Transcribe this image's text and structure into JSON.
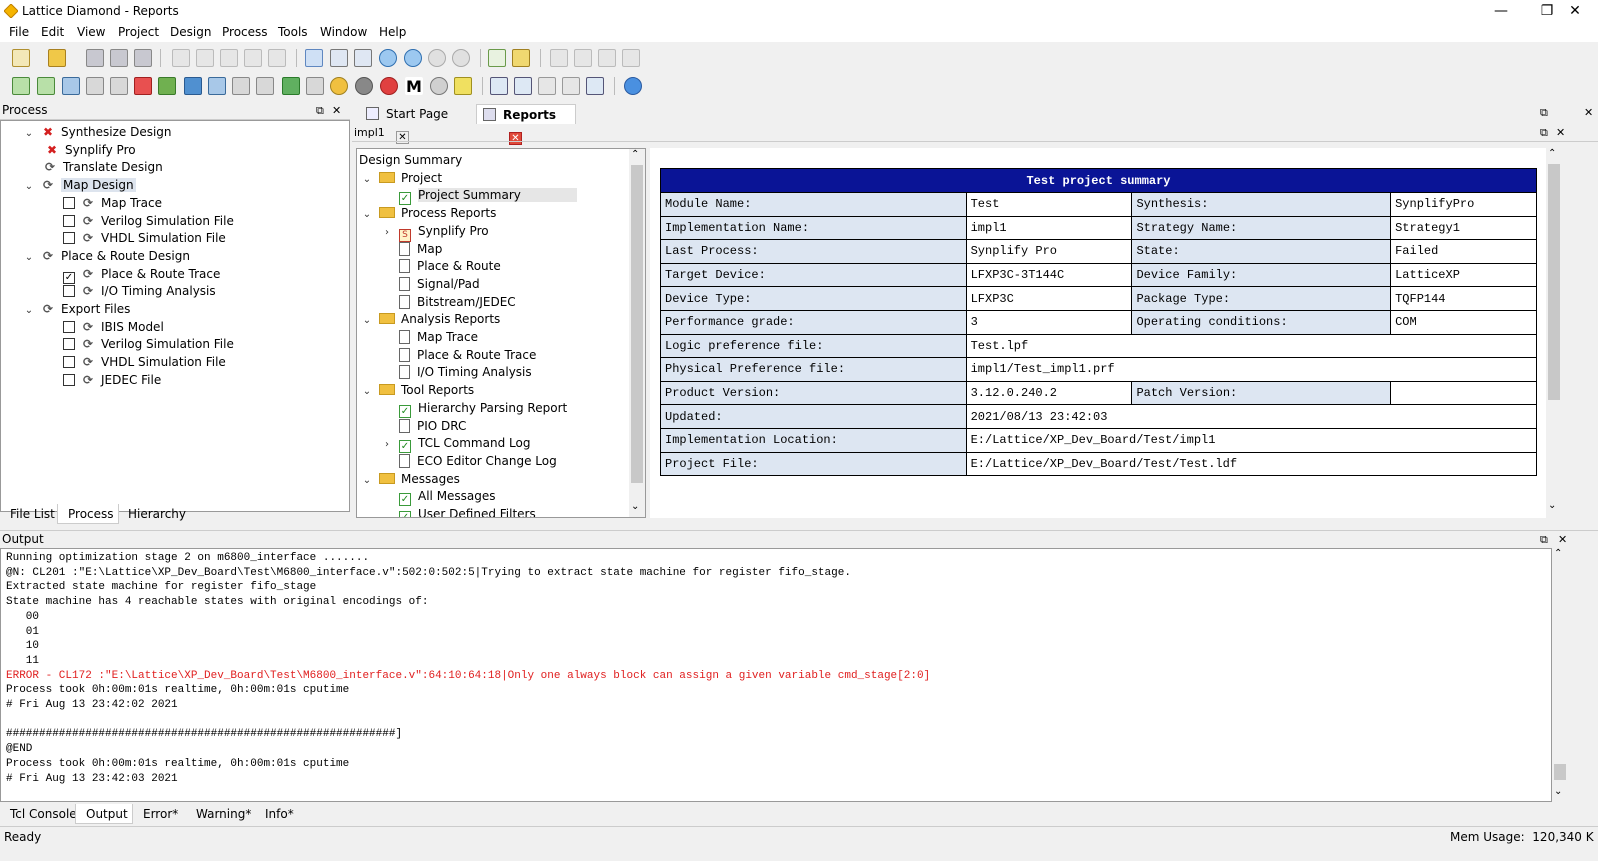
{
  "window": {
    "title": "Lattice Diamond - Reports",
    "min": "—",
    "max": "❐",
    "close": "✕"
  },
  "menu": [
    "File",
    "Edit",
    "View",
    "Project",
    "Design",
    "Process",
    "Tools",
    "Window",
    "Help"
  ],
  "process_pane": {
    "title": "Process",
    "items": [
      {
        "label": "Synthesize Design",
        "indent": 0,
        "caret": "v",
        "icon": "x"
      },
      {
        "label": "Synplify Pro",
        "indent": 1,
        "icon": "x"
      },
      {
        "label": "Translate Design",
        "indent": 0,
        "icon": "cycle"
      },
      {
        "label": "Map Design",
        "indent": 0,
        "caret": "v",
        "icon": "cycle",
        "selected": true
      },
      {
        "label": "Map Trace",
        "indent": 1,
        "check": false,
        "icon": "cycle"
      },
      {
        "label": "Verilog Simulation File",
        "indent": 1,
        "check": false,
        "icon": "cycle"
      },
      {
        "label": "VHDL Simulation File",
        "indent": 1,
        "check": false,
        "icon": "cycle"
      },
      {
        "label": "Place & Route Design",
        "indent": 0,
        "caret": "v",
        "icon": "cycle"
      },
      {
        "label": "Place & Route Trace",
        "indent": 1,
        "check": true,
        "icon": "cycle"
      },
      {
        "label": "I/O Timing Analysis",
        "indent": 1,
        "check": false,
        "icon": "cycle"
      },
      {
        "label": "Export Files",
        "indent": 0,
        "caret": "v",
        "icon": "cycle"
      },
      {
        "label": "IBIS Model",
        "indent": 1,
        "check": false,
        "icon": "cycle"
      },
      {
        "label": "Verilog Simulation File",
        "indent": 1,
        "check": false,
        "icon": "cycle"
      },
      {
        "label": "VHDL Simulation File",
        "indent": 1,
        "check": false,
        "icon": "cycle"
      },
      {
        "label": "JEDEC File",
        "indent": 1,
        "check": false,
        "icon": "cycle"
      }
    ],
    "tabs": [
      "File List",
      "Process",
      "Hierarchy"
    ]
  },
  "doc_tabs": [
    "Start Page",
    "Reports"
  ],
  "impl_label": "impl1",
  "summary_tree": [
    {
      "label": "Design Summary",
      "level": 0,
      "icon": "none"
    },
    {
      "label": "Project",
      "level": 0,
      "caret": "v",
      "icon": "folder"
    },
    {
      "label": "Project Summary",
      "level": 1,
      "icon": "check",
      "selected": true
    },
    {
      "label": "Process Reports",
      "level": 0,
      "caret": "v",
      "icon": "folder"
    },
    {
      "label": "Synplify Pro",
      "level": 1,
      "caret": ">",
      "icon": "synp"
    },
    {
      "label": "Map",
      "level": 1,
      "icon": "doc"
    },
    {
      "label": "Place & Route",
      "level": 1,
      "icon": "doc"
    },
    {
      "label": "Signal/Pad",
      "level": 1,
      "icon": "doc"
    },
    {
      "label": "Bitstream/JEDEC",
      "level": 1,
      "icon": "doc"
    },
    {
      "label": "Analysis Reports",
      "level": 0,
      "caret": "v",
      "icon": "folder"
    },
    {
      "label": "Map Trace",
      "level": 1,
      "icon": "doc"
    },
    {
      "label": "Place & Route Trace",
      "level": 1,
      "icon": "doc"
    },
    {
      "label": "I/O Timing Analysis",
      "level": 1,
      "icon": "doc"
    },
    {
      "label": "Tool Reports",
      "level": 0,
      "caret": "v",
      "icon": "folder"
    },
    {
      "label": "Hierarchy Parsing Report",
      "level": 1,
      "icon": "check"
    },
    {
      "label": "PIO DRC",
      "level": 1,
      "icon": "doc"
    },
    {
      "label": "TCL Command Log",
      "level": 1,
      "caret": ">",
      "icon": "check"
    },
    {
      "label": "ECO Editor Change Log",
      "level": 1,
      "icon": "doc"
    },
    {
      "label": "Messages",
      "level": 0,
      "caret": "v",
      "icon": "folder"
    },
    {
      "label": "All Messages",
      "level": 1,
      "icon": "check"
    },
    {
      "label": "User Defined Filters",
      "level": 1,
      "icon": "check"
    }
  ],
  "report": {
    "title": "Test project summary",
    "rows4": [
      [
        "Module Name:",
        "Test",
        "Synthesis:",
        "SynplifyPro"
      ],
      [
        "Implementation Name:",
        "impl1",
        "Strategy Name:",
        "Strategy1"
      ],
      [
        "Last Process:",
        "Synplify Pro",
        "State:",
        "Failed"
      ],
      [
        "Target Device:",
        "LFXP3C-3T144C",
        "Device Family:",
        "LatticeXP"
      ],
      [
        "Device Type:",
        "LFXP3C",
        "Package Type:",
        "TQFP144"
      ],
      [
        "Performance grade:",
        "3",
        "Operating conditions:",
        "COM"
      ]
    ],
    "rows2a": [
      [
        "Logic preference file:",
        "Test.lpf"
      ],
      [
        "Physical Preference file:",
        "impl1/Test_impl1.prf"
      ]
    ],
    "product_row": [
      "Product Version:",
      "3.12.0.240.2",
      "Patch Version:",
      ""
    ],
    "rows2b": [
      [
        "Updated:",
        "2021/08/13 23:42:03"
      ],
      [
        "Implementation Location:",
        "E:/Lattice/XP_Dev_Board/Test/impl1"
      ],
      [
        "Project File:",
        "E:/Lattice/XP_Dev_Board/Test/Test.ldf"
      ]
    ]
  },
  "output": {
    "title": "Output",
    "lines": [
      {
        "t": "Running optimization stage 2 on m6800_interface .......",
        "err": false
      },
      {
        "t": "@N: CL201 :\"E:\\Lattice\\XP_Dev_Board\\Test\\M6800_interface.v\":502:0:502:5|Trying to extract state machine for register fifo_stage.",
        "err": false
      },
      {
        "t": "Extracted state machine for register fifo_stage",
        "err": false
      },
      {
        "t": "State machine has 4 reachable states with original encodings of:",
        "err": false
      },
      {
        "t": "   00",
        "err": false
      },
      {
        "t": "   01",
        "err": false
      },
      {
        "t": "   10",
        "err": false
      },
      {
        "t": "   11",
        "err": false
      },
      {
        "t": "ERROR - CL172 :\"E:\\Lattice\\XP_Dev_Board\\Test\\M6800_interface.v\":64:10:64:18|Only one always block can assign a given variable cmd_stage[2:0]",
        "err": true
      },
      {
        "t": "Process took 0h:00m:01s realtime, 0h:00m:01s cputime",
        "err": false
      },
      {
        "t": "# Fri Aug 13 23:42:02 2021",
        "err": false
      },
      {
        "t": "",
        "err": false
      },
      {
        "t": "###########################################################]",
        "err": false
      },
      {
        "t": "@END",
        "err": false
      },
      {
        "t": "Process took 0h:00m:01s realtime, 0h:00m:01s cputime",
        "err": false
      },
      {
        "t": "# Fri Aug 13 23:42:03 2021",
        "err": false
      }
    ],
    "tabs": [
      "Tcl Console",
      "Output",
      "Error*",
      "Warning*",
      "Info*"
    ]
  },
  "status": {
    "left": "Ready",
    "right": "Mem Usage:  120,340 K"
  },
  "colors": {
    "report_header": "#0a1496",
    "label_cell": "#dde6f2",
    "error_text": "#e02020"
  }
}
